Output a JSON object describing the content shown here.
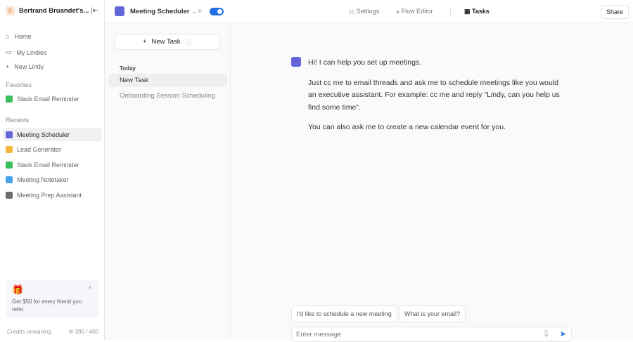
{
  "workspace": {
    "initial": "B",
    "name": "Bertrand Bruandet's..."
  },
  "nav": [
    {
      "label": "Home"
    },
    {
      "label": "My Lindies"
    },
    {
      "label": "New Lindy"
    }
  ],
  "favorites": {
    "title": "Favorites",
    "items": [
      {
        "label": "Slack Email Reminder",
        "color": "#3cbf5a"
      }
    ]
  },
  "recents": {
    "title": "Recents",
    "items": [
      {
        "label": "Meeting Scheduler",
        "color": "#6366d9"
      },
      {
        "label": "Lead Generator",
        "color": "#f2b63c"
      },
      {
        "label": "Slack Email Reminder",
        "color": "#3cbf5a"
      },
      {
        "label": "Meeting Notetaker",
        "color": "#4aa3e8"
      },
      {
        "label": "Meeting Prep Assistant",
        "color": "#6b6b6b"
      }
    ]
  },
  "promo": {
    "text": "Get $50 for every friend you refer."
  },
  "credits": {
    "label": "Credits remaining",
    "value": "390 / 400"
  },
  "header": {
    "agent": "Meeting Scheduler",
    "tabs": [
      {
        "label": "Settings"
      },
      {
        "label": "Flow Editor"
      },
      {
        "label": "Tasks"
      }
    ],
    "share": "Share"
  },
  "task_panel": {
    "new_task": "New Task",
    "group": "Today",
    "items": [
      "New Task",
      "Onboarding Session Scheduling"
    ]
  },
  "chat": {
    "messages": [
      "Hi! I can help you set up meetings.",
      "Just cc me to email threads and ask me to schedule meetings like you would an executive assistant. For example: cc me and reply \"Lindy, can you help us find some time\".",
      "You can also ask me to create a new calendar event for you."
    ],
    "suggestions": [
      "I'd like to schedule a new meeting",
      "What is your email?"
    ],
    "placeholder": "Enter message"
  }
}
